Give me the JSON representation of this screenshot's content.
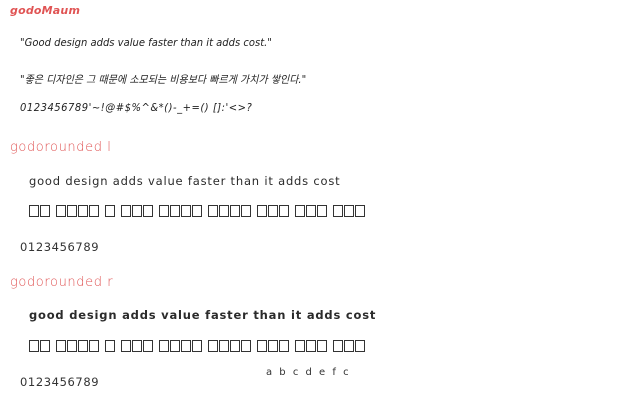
{
  "fonts": [
    {
      "name": "godoMaum",
      "samples": [
        "\"Good design adds value faster than it adds cost.\"",
        "\"좋은 디자인은 그 때문에 소모되는 비용보다 빠르게 가치가 쌓인다.\"",
        "0123456789'~!@#$%^&*()-_+=()  []:'<>?"
      ]
    },
    {
      "name": "godorounded l",
      "english": "good design adds value faster than it adds cost",
      "korean_words": [
        2,
        4,
        1,
        3,
        4,
        4,
        3,
        3,
        3
      ],
      "digits": "0123456789"
    },
    {
      "name": "godorounded r",
      "english": "good design adds value faster than it adds cost",
      "korean_words": [
        2,
        4,
        1,
        3,
        4,
        4,
        3,
        3,
        3
      ],
      "digits": "0123456789",
      "letters": "a b c d e f c"
    }
  ],
  "colors": {
    "accent": "#e05454",
    "text": "#2b2b2b"
  }
}
